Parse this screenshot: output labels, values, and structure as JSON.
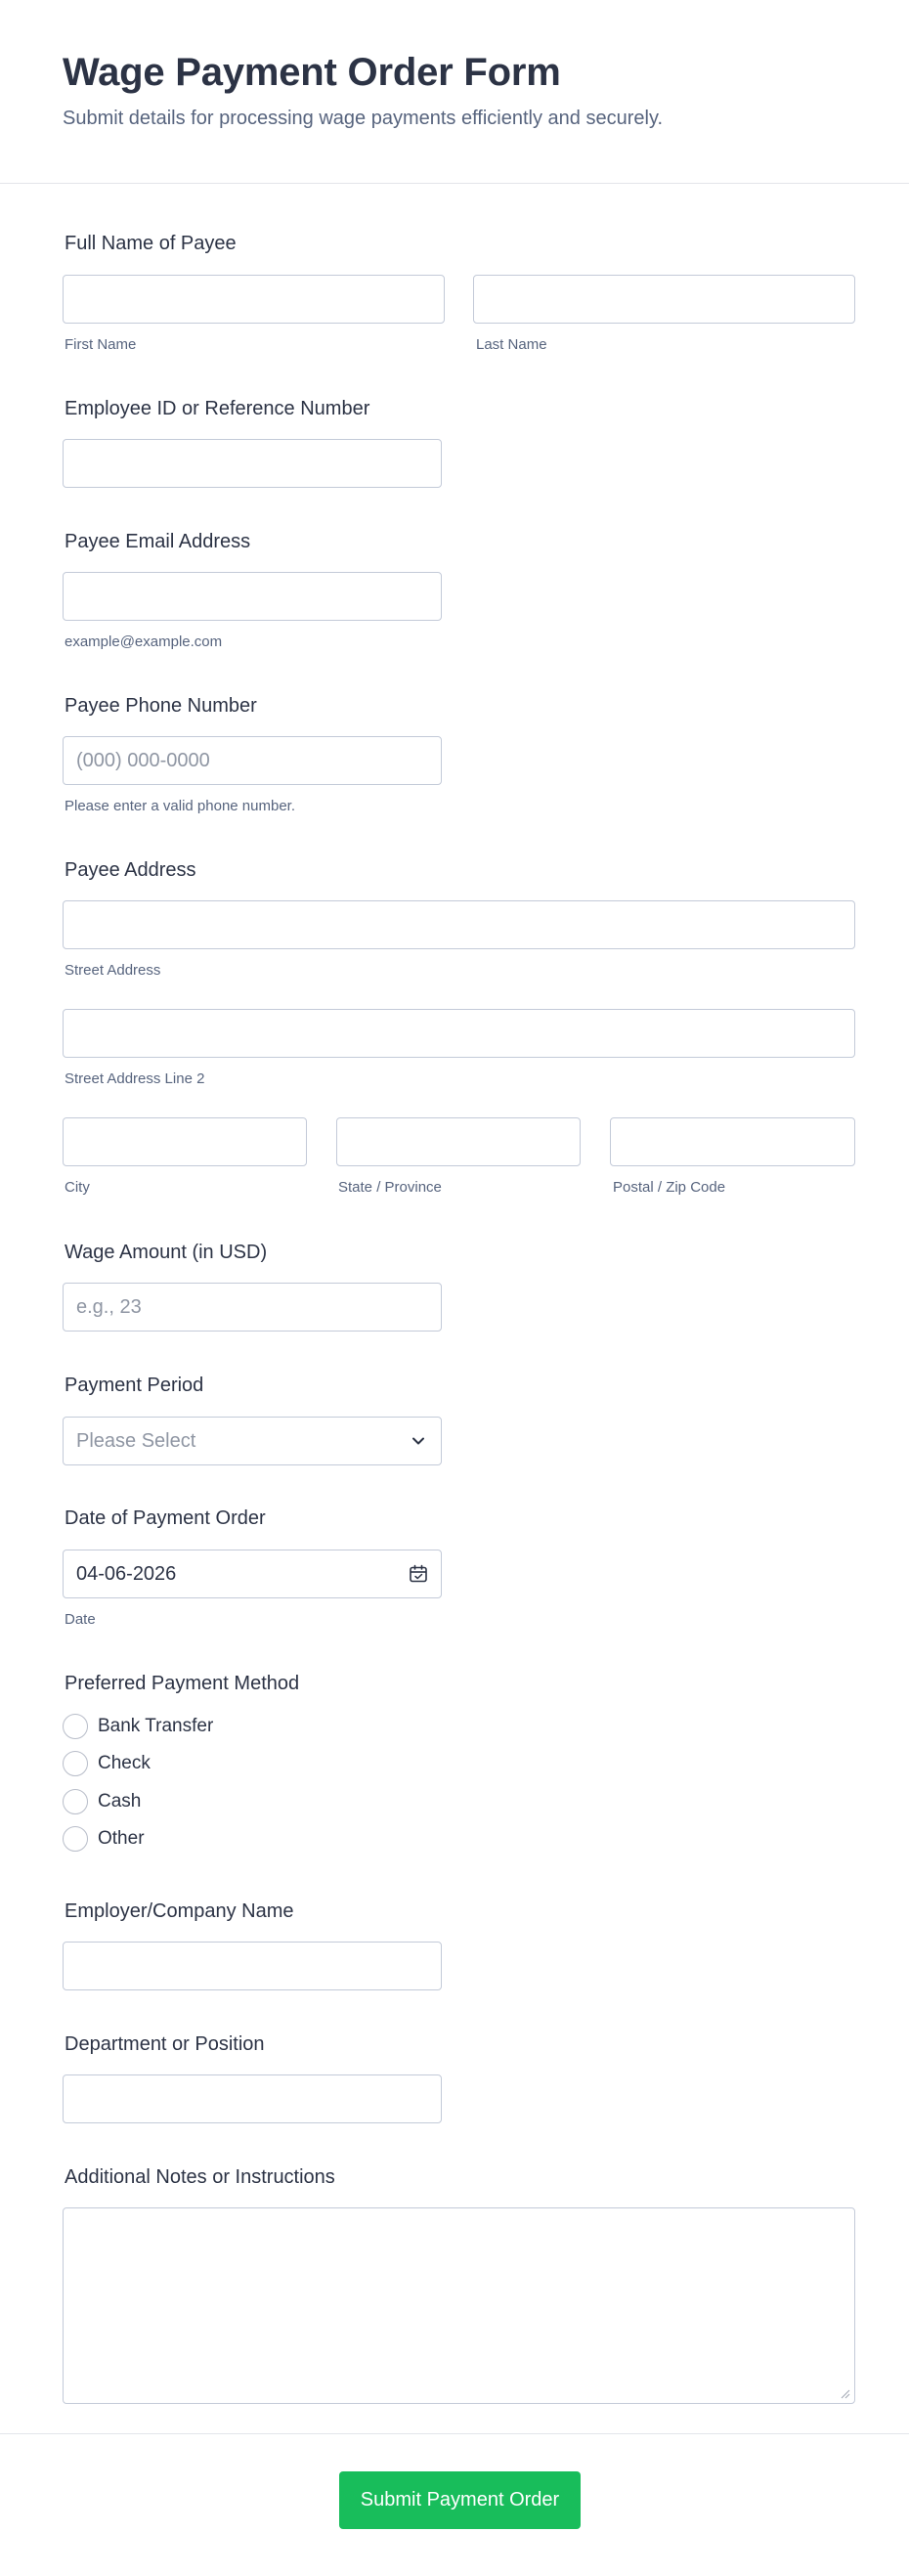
{
  "header": {
    "title": "Wage Payment Order Form",
    "subtitle": "Submit details for processing wage payments efficiently and securely."
  },
  "full_name": {
    "label": "Full Name of Payee",
    "first_sublabel": "First Name",
    "last_sublabel": "Last Name",
    "first_value": "",
    "last_value": ""
  },
  "employee_id": {
    "label": "Employee ID or Reference Number",
    "value": ""
  },
  "email": {
    "label": "Payee Email Address",
    "value": "",
    "sublabel": "example@example.com"
  },
  "phone": {
    "label": "Payee Phone Number",
    "placeholder": "(000) 000-0000",
    "value": "",
    "sublabel": "Please enter a valid phone number."
  },
  "address": {
    "label": "Payee Address",
    "street_sublabel": "Street Address",
    "street2_sublabel": "Street Address Line 2",
    "city_sublabel": "City",
    "state_sublabel": "State / Province",
    "zip_sublabel": "Postal / Zip Code"
  },
  "wage_amount": {
    "label": "Wage Amount (in USD)",
    "placeholder": "e.g., 23",
    "value": ""
  },
  "payment_period": {
    "label": "Payment Period",
    "selected": "Please Select",
    "icon": "chevron-down-icon"
  },
  "payment_date": {
    "label": "Date of Payment Order",
    "value": "04-06-2026",
    "sublabel": "Date",
    "icon": "calendar-icon"
  },
  "payment_method": {
    "label": "Preferred Payment Method",
    "options": [
      "Bank Transfer",
      "Check",
      "Cash",
      "Other"
    ]
  },
  "employer": {
    "label": "Employer/Company Name",
    "value": ""
  },
  "department": {
    "label": "Department or Position",
    "value": ""
  },
  "notes": {
    "label": "Additional Notes or Instructions",
    "value": ""
  },
  "submit": {
    "label": "Submit Payment Order"
  },
  "colors": {
    "primary_text": "#2c3345",
    "secondary_text": "#57647e",
    "border": "#c3cad8",
    "submit_bg": "#18bd5b"
  }
}
